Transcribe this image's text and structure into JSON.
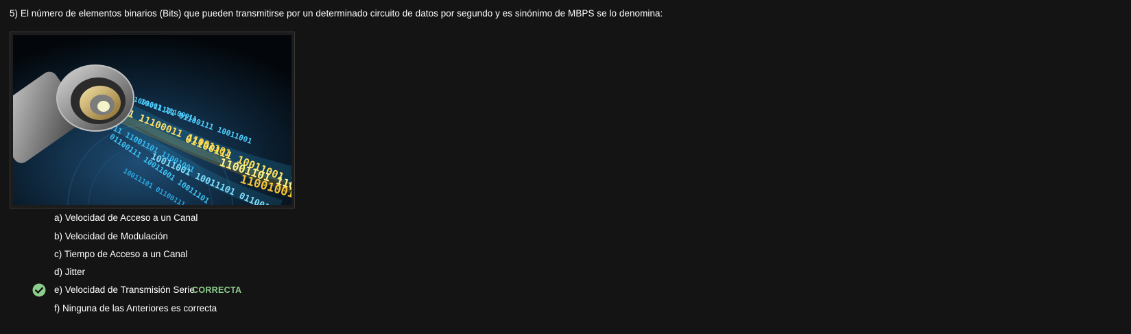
{
  "question": {
    "text": "5) El número de elementos binarios (Bits) que pueden transmitirse por un determinado circuito de datos por segundo y es sinónimo de MBPS se lo denomina:"
  },
  "image": {
    "binary_strings": [
      "11001101",
      "10011101",
      "11001001",
      "01100111",
      "11100011",
      "10011001"
    ]
  },
  "options": [
    {
      "label": "a) Velocidad de Acceso a un Canal",
      "selected": false
    },
    {
      "label": "b) Velocidad de Modulación",
      "selected": false
    },
    {
      "label": "c) Tiempo de Acceso a un Canal",
      "selected": false
    },
    {
      "label": "d) Jitter",
      "selected": false
    },
    {
      "label": "e) Velocidad de Transmisión Serie",
      "selected": true
    },
    {
      "label": "f) Ninguna de las Anteriores es correcta",
      "selected": false
    }
  ],
  "result": {
    "badge": "CORRECTA",
    "icon": "check-circle-icon",
    "color": "#8ccf8c"
  }
}
